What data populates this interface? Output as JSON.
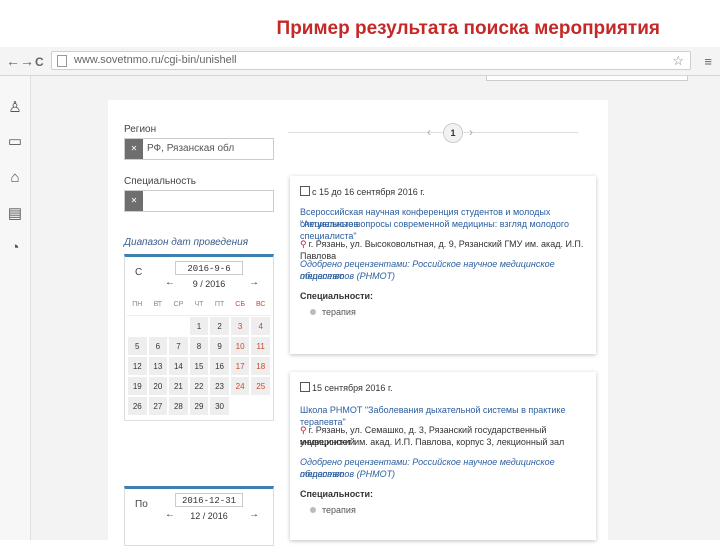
{
  "slide": {
    "title": "Пример результата поиска мероприятия"
  },
  "browser": {
    "url": "www.sovetnmo.ru/cgi-bin/unishell",
    "back": "←",
    "forward": "→",
    "reload": "C",
    "star": "☆",
    "menu": "≡"
  },
  "rail_icons": [
    "person-icon",
    "laptop-icon",
    "building-icon",
    "document-icon",
    "chat-icon"
  ],
  "filters": {
    "region_label": "Регион",
    "region_value": "РФ, Рязанская обл",
    "specialty_label": "Специальность",
    "specialty_value": "",
    "range_label": "Диапазон дат проведения",
    "from": {
      "prefix": "С",
      "date": "2016-9-6",
      "month": "9 / 2016"
    },
    "to": {
      "prefix": "По",
      "date": "2016-12-31",
      "month": "12 / 2016"
    },
    "weekdays": [
      "ПН",
      "ВТ",
      "СР",
      "ЧТ",
      "ПТ",
      "СБ",
      "ВС"
    ],
    "days": [
      "1",
      "2",
      "3",
      "4",
      "5",
      "6",
      "7",
      "8",
      "9",
      "10",
      "11",
      "12",
      "13",
      "14",
      "15",
      "16",
      "17",
      "18",
      "19",
      "20",
      "21",
      "22",
      "23",
      "24",
      "25",
      "26",
      "27",
      "28",
      "29",
      "30"
    ]
  },
  "pager": {
    "prev": "‹",
    "current": "1",
    "next": "›"
  },
  "events": [
    {
      "date": "с 15 до 16 сентября 2016 г.",
      "title_1": "Всероссийская научная конференция студентов и молодых специалистов",
      "title_2": "\"Актуальные вопросы современной медицины: взгляд молодого специалиста\"",
      "address": "г. Рязань, ул. Высоковольтная, д. 9, Рязанский ГМУ им. акад. И.П. Павлова",
      "reviewed_1": "Одобрено рецензентами: Российское научное медицинское общество",
      "reviewed_2": "терапевтов (РНМОТ)",
      "specialties_label": "Специальности:",
      "specialties": [
        "терапия"
      ]
    },
    {
      "date": "15 сентября 2016 г.",
      "title_1": "Школа РНМОТ \"Заболевания дыхательной системы в практике терапевта\"",
      "address_1": "г. Рязань, ул. Семашко, д. 3, Рязанский государственный медицинский",
      "address_2": "университет им. акад. И.П. Павлова, корпус 3, лекционный зал",
      "reviewed_1": "Одобрено рецензентами: Российское научное медицинское общество",
      "reviewed_2": "терапевтов (РНМОТ)",
      "specialties_label": "Специальности:",
      "specialties": [
        "терапия"
      ]
    }
  ],
  "colors": {
    "title": "#c62828",
    "accent": "#3f7fb0",
    "link": "#2a5ea0"
  }
}
